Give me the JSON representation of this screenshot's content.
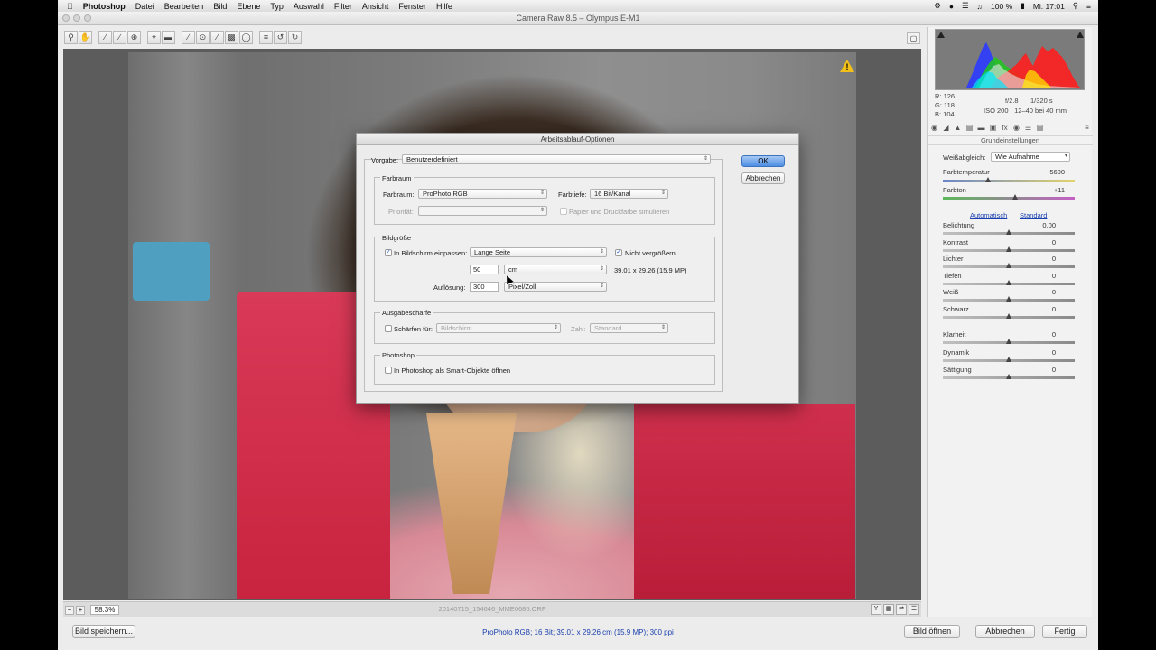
{
  "menubar": {
    "apple": "",
    "app": "Photoshop",
    "items": [
      "Datei",
      "Bearbeiten",
      "Bild",
      "Ebene",
      "Typ",
      "Auswahl",
      "Filter",
      "Ansicht",
      "Fenster",
      "Hilfe"
    ],
    "battery": "100 %",
    "clock": "Mi. 17:01"
  },
  "window": {
    "title": "Camera Raw 8.5  –  Olympus E-M1"
  },
  "toolbar": {
    "tools": [
      "zoom-tool",
      "hand-tool",
      "white-balance-tool",
      "color-sampler-tool",
      "target-adjustment-tool",
      "crop-tool",
      "straighten-tool",
      "spot-removal-tool",
      "red-eye-tool",
      "adjustment-brush-tool",
      "graduated-filter-tool",
      "radial-filter-tool",
      "preferences-tool",
      "rotate-left-tool",
      "rotate-right-tool"
    ],
    "fullscreen_icon": "fullscreen-icon"
  },
  "preview": {
    "warning": "!",
    "zoom": "58.3%",
    "filename": "20140715_154646_MME0686.ORF"
  },
  "histogram": {
    "rgb": [
      "R:  126",
      "G:  118",
      "B:  104"
    ],
    "aperture": "f/2.8",
    "shutter": "1/320 s",
    "iso": "ISO 200",
    "lens": "12–40 bei 40 mm"
  },
  "panel": {
    "title": "Grundeinstellungen",
    "wb_label": "Weißabgleich:",
    "wb_value": "Wie Aufnahme",
    "temperature_label": "Farbtemperatur",
    "temperature_value": "5600",
    "temperature_pos": 0.34,
    "tint_label": "Farbton",
    "tint_value": "+11",
    "tint_pos": 0.55,
    "auto_link": "Automatisch",
    "default_link": "Standard",
    "sliders": [
      {
        "label": "Belichtung",
        "value": "0.00",
        "pos": 0.5
      },
      {
        "label": "Kontrast",
        "value": "0",
        "pos": 0.5
      },
      {
        "label": "Lichter",
        "value": "0",
        "pos": 0.5
      },
      {
        "label": "Tiefen",
        "value": "0",
        "pos": 0.5
      },
      {
        "label": "Weiß",
        "value": "0",
        "pos": 0.5
      },
      {
        "label": "Schwarz",
        "value": "0",
        "pos": 0.5
      }
    ],
    "sliders2": [
      {
        "label": "Klarheit",
        "value": "0",
        "pos": 0.5
      },
      {
        "label": "Dynamik",
        "value": "0",
        "pos": 0.5
      },
      {
        "label": "Sättigung",
        "value": "0",
        "pos": 0.5
      }
    ]
  },
  "bottom": {
    "save": "Bild speichern...",
    "info": "ProPhoto RGB; 16 Bit; 39.01 x 29.26 cm (15.9 MP); 300 ppi",
    "open": "Bild öffnen",
    "cancel": "Abbrechen",
    "done": "Fertig"
  },
  "dialog": {
    "title": "Arbeitsablauf-Optionen",
    "preset_label": "Vorgabe:",
    "preset_value": "Benutzerdefiniert",
    "ok": "OK",
    "cancel": "Abbrechen",
    "colorspace": {
      "group": "Farbraum",
      "space_label": "Farbraum:",
      "space_value": "ProPhoto RGB",
      "depth_label": "Farbtiefe:",
      "depth_value": "16 Bit/Kanal",
      "priority_label": "Priorität:",
      "priority_value": "",
      "simulate_label": "Papier und Druckfarbe simulieren"
    },
    "imagesize": {
      "group": "Bildgröße",
      "fit_label": "In Bildschirm einpassen:",
      "fit_value": "Lange Seite",
      "no_enlarge_label": "Nicht vergrößern",
      "size_value": "50",
      "unit_value": "cm",
      "dimensions": "39.01 x 29.26 (15.9 MP)",
      "resolution_label": "Auflösung:",
      "resolution_value": "300",
      "resolution_unit": "Pixel/Zoll"
    },
    "sharpen": {
      "group": "Ausgabeschärfe",
      "sharpen_label": "Schärfen für:",
      "sharpen_value": "Bildschirm",
      "amount_label": "Zahl:",
      "amount_value": "Standard"
    },
    "photoshop": {
      "group": "Photoshop",
      "smart_label": "In Photoshop als Smart-Objekte öffnen"
    }
  },
  "colors": {
    "accent": "#4d8ee4",
    "warning": "#f2c018",
    "link": "#1a3fae"
  }
}
